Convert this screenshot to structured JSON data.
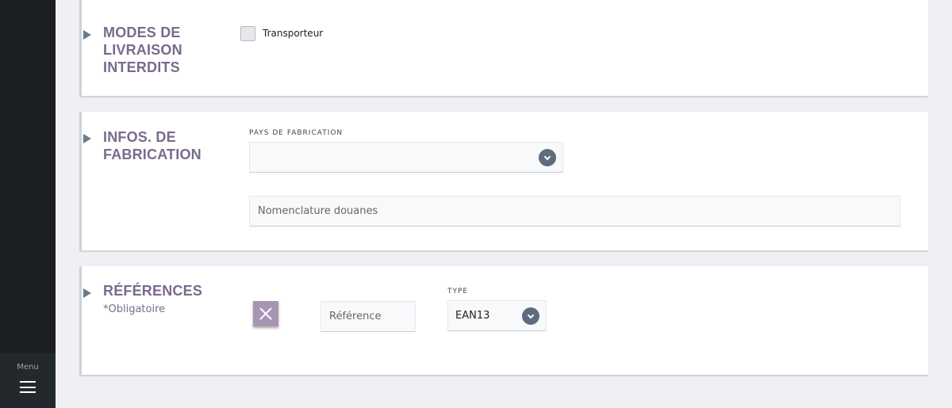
{
  "sidebar": {
    "menu_label": "Menu"
  },
  "sections": {
    "delivery": {
      "title_lines": [
        "MODES DE",
        "LIVRAISON",
        "INTERDITS"
      ],
      "checkbox_label": "Transporteur",
      "checked": false
    },
    "manufacturing": {
      "title_lines": [
        "INFOS. DE",
        "FABRICATION"
      ],
      "country_label": "PAYS DE FABRICATION",
      "country_value": "",
      "customs_placeholder": "Nomenclature douanes"
    },
    "references": {
      "title": "RÉFÉRENCES",
      "subtitle": "*Obligatoire",
      "reference_placeholder": "Référence",
      "type_label": "TYPE",
      "type_value": "EAN13"
    }
  },
  "icons": {
    "expand": "triangle-right-icon",
    "dropdown": "chevron-down-icon",
    "delete": "close-icon",
    "menu": "hamburger-icon"
  },
  "colors": {
    "sidebar": "#1b1f22",
    "title": "#7a6a8e",
    "accent_button": "#a895b5",
    "dropdown_icon": "#5d6d7e",
    "background": "#f0eff3"
  }
}
